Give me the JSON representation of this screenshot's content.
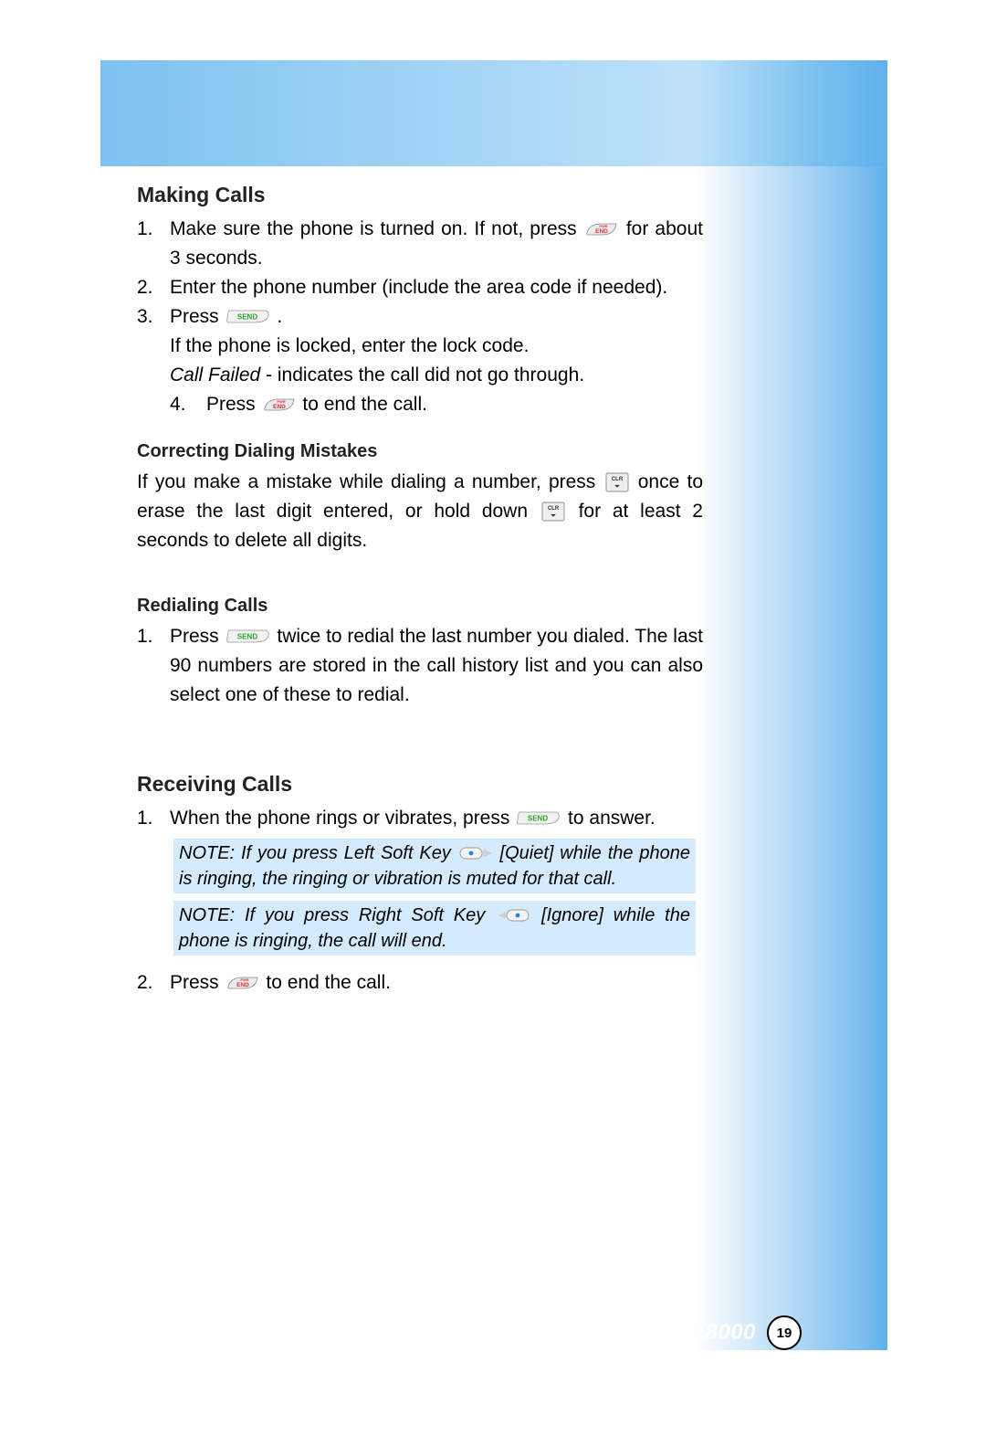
{
  "footer": {
    "model": "VX8000",
    "page_number": "19"
  },
  "keys": {
    "end_label_top": "PWR",
    "end_label": "END",
    "send_label": "SEND",
    "clr_label_top": "CLR",
    "clr_label_bottom": "⏻"
  },
  "sections": {
    "making_calls": {
      "title": "Making Calls",
      "item1_num": "1.",
      "item1_a": "Make sure the phone is turned on. If not, press ",
      "item1_b": " for about 3 seconds.",
      "item2_num": "2.",
      "item2": "Enter the phone number (include the area code if needed).",
      "item3_num": "3.",
      "item3_a": "Press ",
      "item3_b": " .",
      "item3_line2": "If the phone is locked, enter the lock code.",
      "item3_line3_i": "Call Failed",
      "item3_line3_rest": " - indicates the call did not go through.",
      "item4_num": "4.",
      "item4_a": "Press ",
      "item4_b": " to end the call."
    },
    "correcting": {
      "title": "Correcting Dialing Mistakes",
      "p1_a": "If you make a mistake while dialing a number, press ",
      "p1_b": " once to erase the last digit entered, or hold down ",
      "p1_c": " for at least 2 seconds to delete all digits."
    },
    "redial": {
      "title": "Redialing Calls",
      "item1_num": "1.",
      "item1_a": "Press ",
      "item1_b": " twice to redial the last number you dialed. The last 90 numbers are stored in the call history list and you can also select one of these to redial."
    },
    "receiving": {
      "title": "Receiving Calls",
      "item1_num": "1.",
      "item1_a": "When the phone rings or vibrates, press ",
      "item1_b": " to answer.",
      "note1_a": "NOTE: If you press Left Soft Key ",
      "note1_b": " [Quiet] while the phone is ringing, the ringing or vibration is muted for that call.",
      "note2_a": "NOTE: If you press Right Soft Key ",
      "note2_b": " [Ignore] while the phone is ringing,  the call  will end.",
      "item2_num": "2.",
      "item2_a": "Press ",
      "item2_b": " to end the call."
    }
  }
}
